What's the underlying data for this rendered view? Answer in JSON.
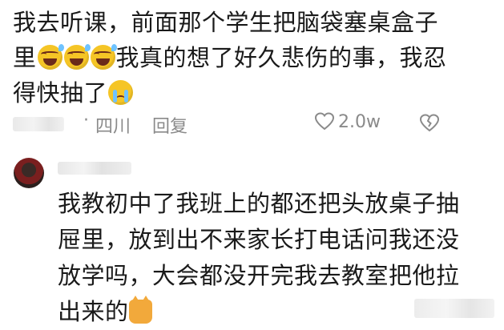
{
  "comment1": {
    "line1": "我去听课，前面那个学生把脑袋塞桌盒子",
    "line2_prefix": "里",
    "line2_suffix": "我真的想了好久悲伤的事，我忍",
    "line3_prefix": "得快抽了",
    "emojis": [
      "laughing-tears-icon",
      "laughing-tears-icon",
      "laughing-tears-icon",
      "crying-icon"
    ],
    "meta": {
      "separator": "·",
      "location": "四川",
      "reply_label": "回复",
      "like_count": "2.0w"
    }
  },
  "comment2": {
    "line1": "我教初中了我班上的都还把头放桌子抽",
    "line2": "屉里，放到出不来家长打电话问我还没",
    "line3": "放学吗，大会都没开完我去教室把他拉",
    "line4": "出来的",
    "emoji": "cat-icon"
  },
  "colors": {
    "text": "#1a1a1a",
    "meta": "#8a8a8a",
    "emoji": "#f5c526"
  }
}
